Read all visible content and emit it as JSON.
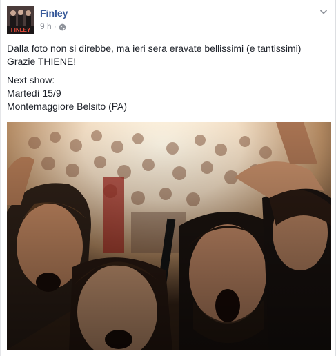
{
  "post": {
    "author": "Finley",
    "avatar_label": "FINLEY",
    "timestamp": "9 h",
    "separator": "·",
    "privacy_icon": "globe-icon",
    "menu_icon": "chevron-down-icon",
    "message_lines": [
      "Dalla foto non si direbbe, ma ieri sera eravate bellissimi (e tantissimi)",
      "Grazie THIENE!"
    ],
    "show_lines": [
      "Next show:",
      "Martedì 15/9",
      "Montemaggiore Belsito (PA)"
    ]
  },
  "colors": {
    "author_link": "#365899",
    "meta_text": "#90949c",
    "body_text": "#1d2129"
  }
}
